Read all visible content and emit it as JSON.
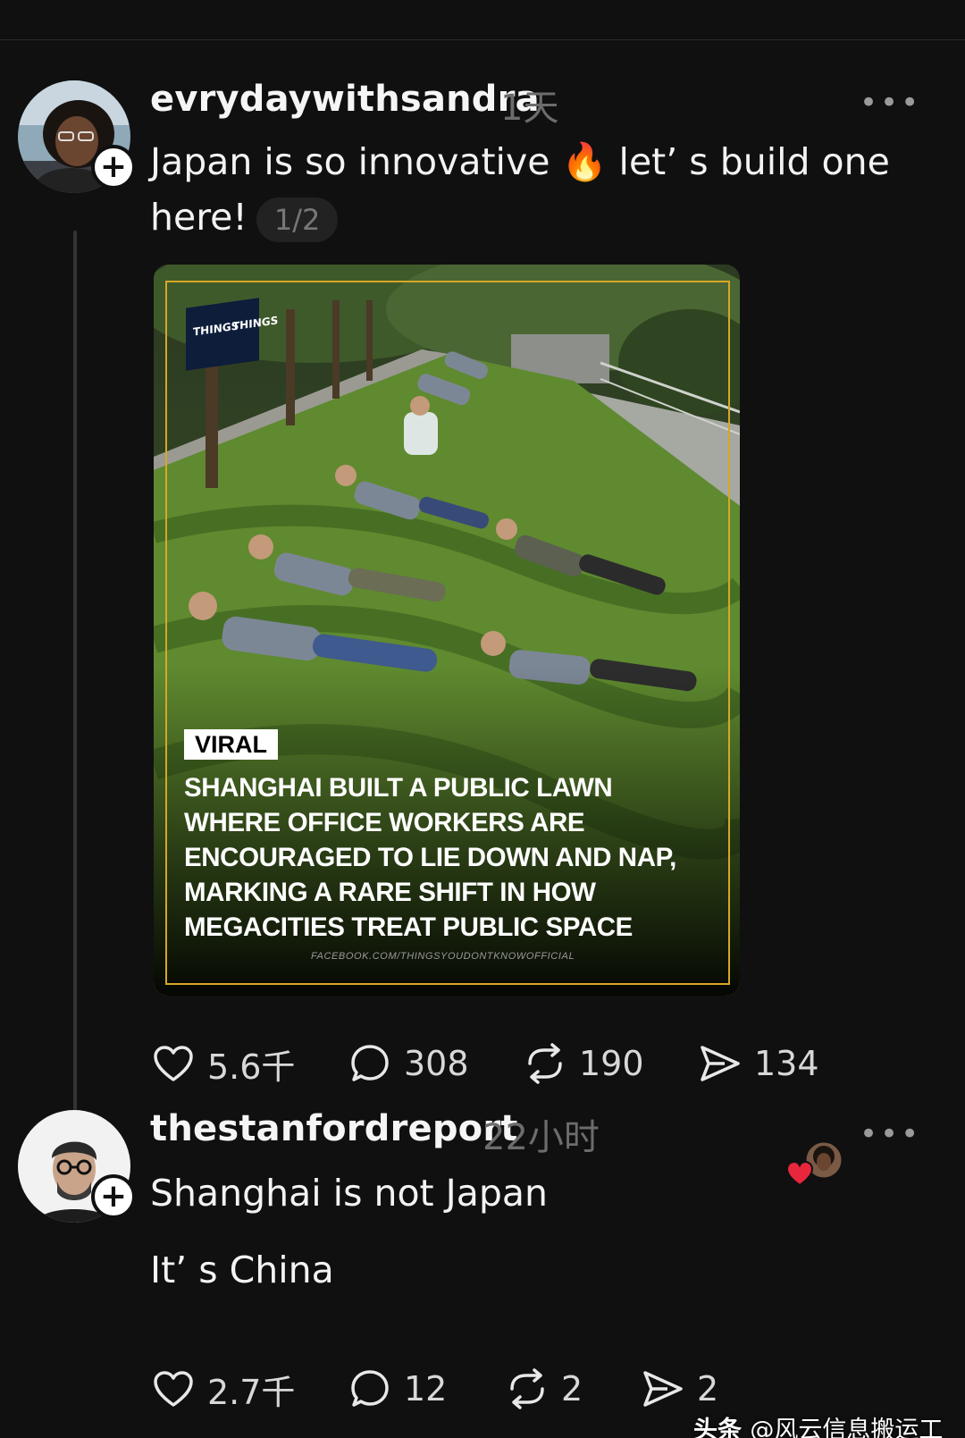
{
  "post": {
    "username": "evrydaywithsandra",
    "time": "1天",
    "text_line1": "Japan is so innovative 🔥 let’ s build one",
    "text_line2": "here!",
    "image_counter": "1/2",
    "image": {
      "brand_left": "THINGS",
      "brand_right": "THINGS",
      "tag": "VIRAL",
      "headline": [
        "SHANGHAI BUILT A PUBLIC LAWN",
        "WHERE OFFICE WORKERS ARE",
        "ENCOURAGED TO LIE DOWN AND NAP,",
        "MARKING A RARE SHIFT IN HOW",
        "MEGACITIES TREAT PUBLIC SPACE"
      ],
      "source_url": "FACEBOOK.COM/THINGSYOUDONTKNOWOFFICIAL"
    },
    "actions": {
      "likes": "5.6千",
      "comments": "308",
      "reposts": "190",
      "shares": "134"
    }
  },
  "reply": {
    "username": "thestanfordreport",
    "time": "22小时",
    "line1": "Shanghai is not Japan",
    "line2": "It’ s China",
    "actions": {
      "likes": "2.7千",
      "comments": "12",
      "reposts": "2",
      "shares": "2"
    }
  },
  "watermark": {
    "brand": "头条",
    "handle": "@风云信息搬运工"
  },
  "ui": {
    "more": "•••",
    "follow": "+"
  },
  "colors": {
    "background": "#101010",
    "accent_border": "#d6a728",
    "like_heart": "#e8263c"
  },
  "icons": [
    "heart-icon",
    "comment-icon",
    "repost-icon",
    "share-icon",
    "more-icon",
    "plus-icon"
  ]
}
